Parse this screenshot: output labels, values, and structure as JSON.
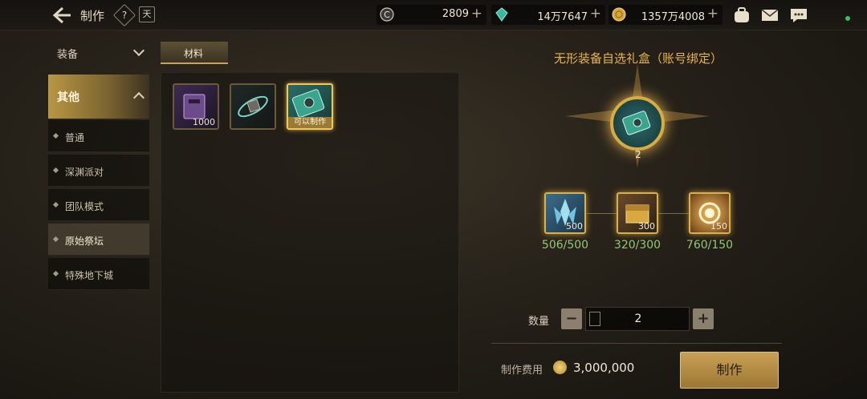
{
  "header": {
    "title": "制作",
    "help_glyph": "?",
    "calendar_glyph": "天"
  },
  "currencies": [
    {
      "name": "c-coin",
      "value": "2809"
    },
    {
      "name": "crystal",
      "value": "14万7647"
    },
    {
      "name": "gold",
      "value": "1357万4008"
    }
  ],
  "currency_plus": "+",
  "nav": {
    "equip": "装备",
    "other": "其他",
    "sub_items": [
      "普通",
      "深渊派对",
      "团队模式",
      "原始祭坛",
      "特殊地下城"
    ],
    "active_index": 3
  },
  "materials_tab": "材料",
  "material_slots": [
    {
      "icon": "dark-tome-icon",
      "count": "1000"
    },
    {
      "icon": "orbit-ore-icon",
      "count": ""
    },
    {
      "icon": "invisible-gear-box-icon",
      "status": "可以制作"
    }
  ],
  "detail": {
    "title": "无形装备自选礼盒（账号绑定）",
    "output_count": "2",
    "requirements": [
      {
        "icon": "crystal-cluster-icon",
        "need": "500",
        "have": "506/500"
      },
      {
        "icon": "gold-chest-icon",
        "need": "300",
        "have": "320/300"
      },
      {
        "icon": "radiant-orb-icon",
        "need": "150",
        "have": "760/150"
      }
    ],
    "quantity_label": "数量",
    "quantity": "2",
    "minus": "−",
    "plus": "+",
    "cost_label": "制作费用",
    "cost_value": "3,000,000",
    "make_button": "制作"
  },
  "colors": {
    "accent_gold": "#e7b44d",
    "have_green": "#93c873"
  }
}
